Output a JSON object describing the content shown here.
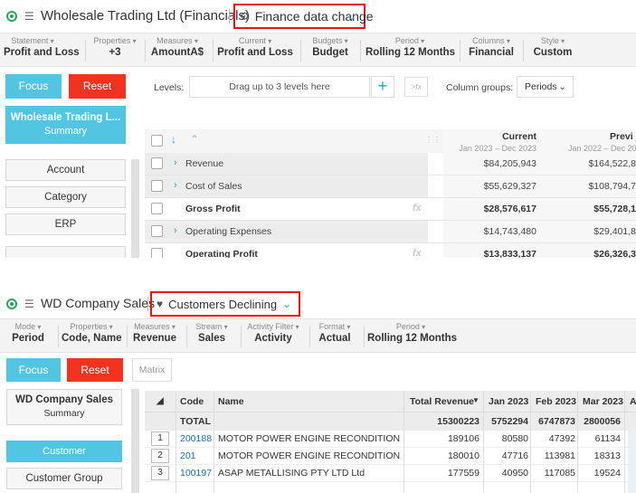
{
  "top": {
    "app_title": "Wholesale Trading Ltd (Financials)",
    "view_name": "Finance data change",
    "toolbar": [
      {
        "caption": "Statement",
        "value": "Profit and Loss"
      },
      {
        "caption": "Properties",
        "value": "+3"
      },
      {
        "caption": "Measures",
        "value": "AmountA$"
      },
      {
        "caption": "Current",
        "value": "Profit and Loss"
      },
      {
        "caption": "Budgets",
        "value": "Budget"
      },
      {
        "caption": "Period",
        "value": "Rolling 12 Months"
      },
      {
        "caption": "Columns",
        "value": "Financial"
      },
      {
        "caption": "Style",
        "value": "Custom"
      }
    ],
    "focus_label": "Focus",
    "reset_label": "Reset",
    "summary_card": {
      "title": "Wholesale Trading L...",
      "subtitle": "Summary"
    },
    "side_items": [
      "Account",
      "Category",
      "ERP"
    ],
    "levels_label": "Levels:",
    "levels_placeholder": "Drag up to 3 levels here",
    "levels_plus": "+",
    "fx_label": ">fx",
    "column_groups_label": "Column groups:",
    "column_groups_value": "Periods",
    "columns": [
      {
        "title": "Current",
        "subtitle": "Jan 2023 – Dec 2023"
      },
      {
        "title": "Previ",
        "subtitle": "Jan 2022 – Dec 20"
      }
    ],
    "rows": [
      {
        "label": "Revenue",
        "expandable": true,
        "bold": false,
        "fx": false,
        "current": "$84,205,943",
        "previous": "$164,522,8"
      },
      {
        "label": "Cost of Sales",
        "expandable": true,
        "bold": false,
        "fx": false,
        "current": "$55,629,327",
        "previous": "$108,794,7"
      },
      {
        "label": "Gross Profit",
        "expandable": false,
        "bold": true,
        "fx": true,
        "current": "$28,576,617",
        "previous": "$55,728,1"
      },
      {
        "label": "Operating Expenses",
        "expandable": true,
        "bold": false,
        "fx": false,
        "current": "$14,743,480",
        "previous": "$29,401,8"
      },
      {
        "label": "Operating Profit",
        "expandable": false,
        "bold": true,
        "fx": true,
        "current": "$13,833,137",
        "previous": "$26,326,3"
      }
    ]
  },
  "bottom": {
    "app_title": "WD Company Sales",
    "view_name": "Customers Declining",
    "toolbar": [
      {
        "caption": "Mode",
        "value": "Period"
      },
      {
        "caption": "Properties",
        "value": "Code, Name"
      },
      {
        "caption": "Measures",
        "value": "Revenue"
      },
      {
        "caption": "Stream",
        "value": "Sales"
      },
      {
        "caption": "Activity Filter",
        "value": "Activity"
      },
      {
        "caption": "Format",
        "value": "Actual"
      },
      {
        "caption": "Period",
        "value": "Rolling 12 Months"
      }
    ],
    "focus_label": "Focus",
    "reset_label": "Reset",
    "matrix_label": "Matrix",
    "summary_card": {
      "title": "WD Company Sales",
      "subtitle": "Summary"
    },
    "side_items": [
      "Customer",
      "Customer Group"
    ],
    "headers": {
      "sort": "◢",
      "code": "Code",
      "name": "Name",
      "total": "Total Revenue",
      "m1": "Jan 2023",
      "m2": "Feb 2023",
      "m3": "Mar 2023",
      "m4": "A"
    },
    "total_row": {
      "label": "TOTAL",
      "total": "15300223",
      "m1": "5752294",
      "m2": "6747873",
      "m3": "2800056"
    },
    "rows": [
      {
        "num": "1",
        "code": "200188",
        "name": "MOTOR POWER ENGINE RECONDITION Pty",
        "total": "189106",
        "m1": "80580",
        "m2": "47392",
        "m3": "61134"
      },
      {
        "num": "2",
        "code": "201",
        "name": "MOTOR POWER ENGINE RECONDITION Ltd",
        "total": "180010",
        "m1": "47716",
        "m2": "113981",
        "m3": "18313"
      },
      {
        "num": "3",
        "code": "100197",
        "name": "ASAP METALLISING PTY LTD Ltd",
        "total": "177559",
        "m1": "40950",
        "m2": "117085",
        "m3": "19524"
      }
    ]
  }
}
